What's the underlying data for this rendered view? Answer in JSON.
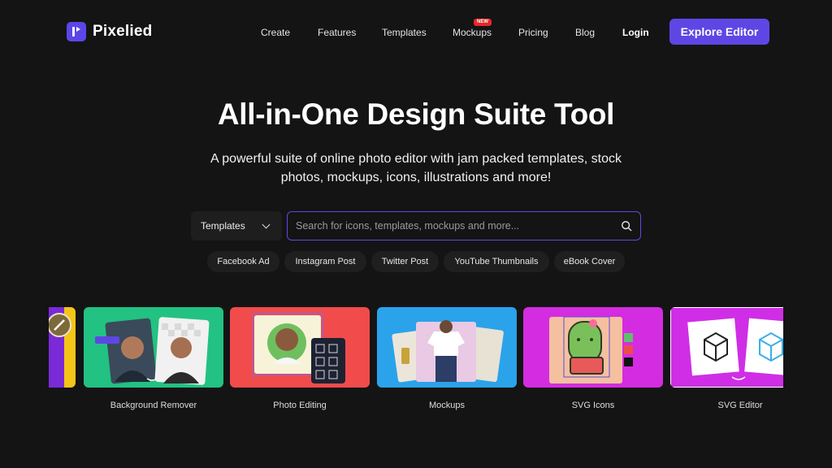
{
  "brand": {
    "name": "Pixelied"
  },
  "nav": {
    "links": [
      "Create",
      "Features",
      "Templates",
      "Mockups",
      "Pricing",
      "Blog"
    ],
    "badge": "NEW",
    "login": "Login",
    "cta": "Explore Editor"
  },
  "hero": {
    "title": "All-in-One Design Suite Tool",
    "subtitle": "A powerful suite of online photo editor with jam packed templates, stock photos, mockups, icons, illustrations and more!"
  },
  "search": {
    "category": "Templates",
    "placeholder": "Search for icons, templates, mockups and more..."
  },
  "tags": [
    "Facebook Ad",
    "Instagram Post",
    "Twitter Post",
    "YouTube Thumbnails",
    "eBook Cover"
  ],
  "features": [
    {
      "label": "Background Remover",
      "color": "#22c282"
    },
    {
      "label": "Photo Editing",
      "color": "#f24b4b"
    },
    {
      "label": "Mockups",
      "color": "#2aa3eb"
    },
    {
      "label": "SVG Icons",
      "color": "#d42ce0"
    },
    {
      "label": "SVG Editor",
      "color": "#cf2ee6"
    }
  ],
  "colors": {
    "accent": "#5e46e5",
    "badge": "#e62727",
    "background": "#141414"
  }
}
